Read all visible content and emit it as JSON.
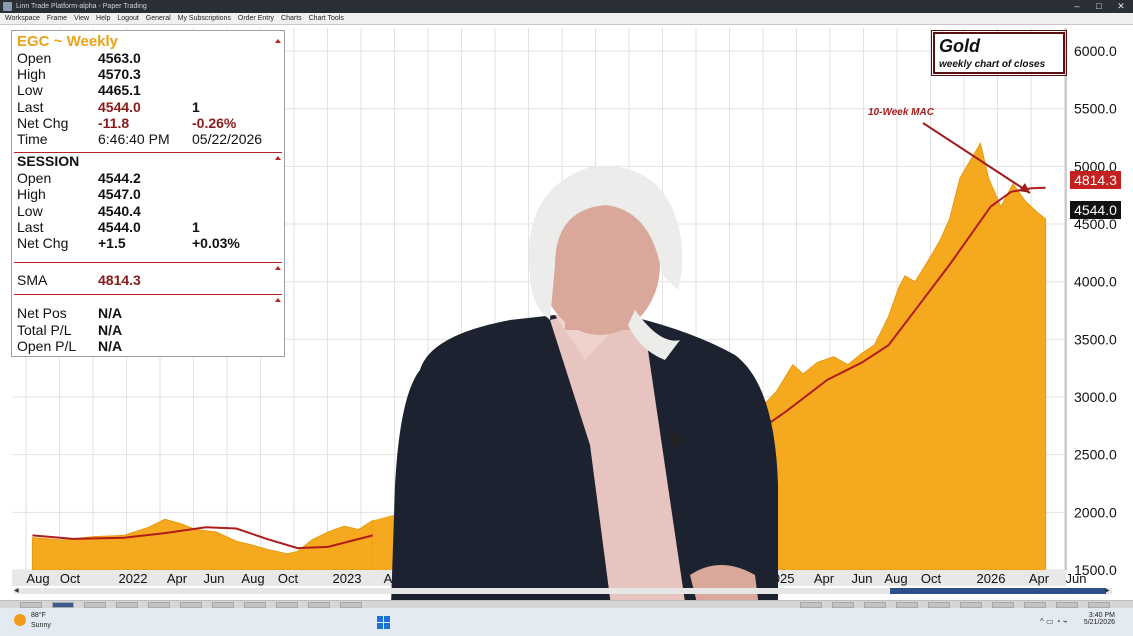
{
  "window": {
    "title": "Linn Trade Platform-alpha - Paper Trading",
    "minimize": "–",
    "maximize": "□",
    "close": "✕"
  },
  "menu": [
    "Workspace",
    "Frame",
    "View",
    "Help",
    "Logout",
    "General",
    "My Subscriptions",
    "Order Entry",
    "Charts",
    "Chart Tools"
  ],
  "info_panel": {
    "title": "EGC ~ Weekly",
    "quote": {
      "open_label": "Open",
      "open": "4563.0",
      "high_label": "High",
      "high": "4570.3",
      "low_label": "Low",
      "low": "4465.1",
      "last_label": "Last",
      "last": "4544.0",
      "last_qty": "1",
      "netchg_label": "Net Chg",
      "netchg": "-11.8",
      "netchg_pct": "-0.26%",
      "time_label": "Time",
      "time": "6:46:40 PM",
      "date": "05/22/2026"
    },
    "session": {
      "header": "SESSION",
      "open_label": "Open",
      "open": "4544.2",
      "high_label": "High",
      "high": "4547.0",
      "low_label": "Low",
      "low": "4540.4",
      "last_label": "Last",
      "last": "4544.0",
      "last_qty": "1",
      "netchg_label": "Net Chg",
      "netchg": "+1.5",
      "netchg_pct": "+0.03%"
    },
    "sma_label": "SMA",
    "sma": "4814.3",
    "netpos_label": "Net Pos",
    "netpos": "N/A",
    "totalpl_label": "Total P/L",
    "totalpl": "N/A",
    "openpl_label": "Open P/L",
    "openpl": "N/A"
  },
  "chart_data": {
    "type": "area",
    "title": "Gold",
    "subtitle": "weekly chart of closes",
    "annotation": "10-Week MAC",
    "ylim": [
      1500,
      6200
    ],
    "yticks": [
      "1500.0",
      "2000.0",
      "2500.0",
      "3000.0",
      "3500.0",
      "4000.0",
      "4500.0",
      "5000.0",
      "5500.0",
      "6000.0"
    ],
    "xticks": [
      "Aug",
      "Oct",
      "2022",
      "Apr",
      "Jun",
      "Aug",
      "Oct",
      "2023",
      "A",
      "2025",
      "Apr",
      "Jun",
      "Aug",
      "Oct",
      "2026",
      "Apr",
      "Jun"
    ],
    "sma_price": "4814.3",
    "last_price": "4544.0",
    "grid": true,
    "series": [
      {
        "name": "EGC",
        "kind": "area",
        "points": [
          [
            2021.55,
            1780
          ],
          [
            2021.7,
            1760
          ],
          [
            2021.85,
            1790
          ],
          [
            2022.0,
            1800
          ],
          [
            2022.12,
            1870
          ],
          [
            2022.2,
            1940
          ],
          [
            2022.28,
            1900
          ],
          [
            2022.35,
            1850
          ],
          [
            2022.45,
            1830
          ],
          [
            2022.55,
            1750
          ],
          [
            2022.62,
            1720
          ],
          [
            2022.7,
            1680
          ],
          [
            2022.8,
            1640
          ],
          [
            2022.85,
            1660
          ],
          [
            2022.92,
            1760
          ],
          [
            2023.0,
            1830
          ],
          [
            2023.08,
            1880
          ],
          [
            2023.15,
            1850
          ],
          [
            2023.22,
            1930
          ],
          [
            2024.85,
            2700
          ],
          [
            2024.95,
            2650
          ],
          [
            2025.05,
            2780
          ],
          [
            2025.12,
            2900
          ],
          [
            2025.2,
            3050
          ],
          [
            2025.28,
            3280
          ],
          [
            2025.33,
            3200
          ],
          [
            2025.4,
            3300
          ],
          [
            2025.48,
            3350
          ],
          [
            2025.55,
            3280
          ],
          [
            2025.62,
            3380
          ],
          [
            2025.68,
            3450
          ],
          [
            2025.75,
            3700
          ],
          [
            2025.8,
            3950
          ],
          [
            2025.83,
            4050
          ],
          [
            2025.88,
            4000
          ],
          [
            2025.95,
            4200
          ],
          [
            2026.0,
            4350
          ],
          [
            2026.05,
            4550
          ],
          [
            2026.1,
            4900
          ],
          [
            2026.15,
            5050
          ],
          [
            2026.2,
            5200
          ],
          [
            2026.24,
            4900
          ],
          [
            2026.3,
            4650
          ],
          [
            2026.36,
            4850
          ],
          [
            2026.42,
            4700
          ],
          [
            2026.48,
            4600
          ],
          [
            2026.52,
            4544
          ]
        ]
      },
      {
        "name": "SMA",
        "kind": "line",
        "points": [
          [
            2021.55,
            1800
          ],
          [
            2021.75,
            1770
          ],
          [
            2022.0,
            1780
          ],
          [
            2022.2,
            1820
          ],
          [
            2022.4,
            1870
          ],
          [
            2022.55,
            1860
          ],
          [
            2022.7,
            1770
          ],
          [
            2022.85,
            1690
          ],
          [
            2023.0,
            1700
          ],
          [
            2023.22,
            1800
          ],
          [
            2024.85,
            2550
          ],
          [
            2025.05,
            2630
          ],
          [
            2025.25,
            2880
          ],
          [
            2025.45,
            3150
          ],
          [
            2025.62,
            3300
          ],
          [
            2025.75,
            3450
          ],
          [
            2025.9,
            3800
          ],
          [
            2026.05,
            4150
          ],
          [
            2026.15,
            4400
          ],
          [
            2026.25,
            4650
          ],
          [
            2026.35,
            4780
          ],
          [
            2026.45,
            4810
          ],
          [
            2026.52,
            4814
          ]
        ]
      }
    ]
  }
}
